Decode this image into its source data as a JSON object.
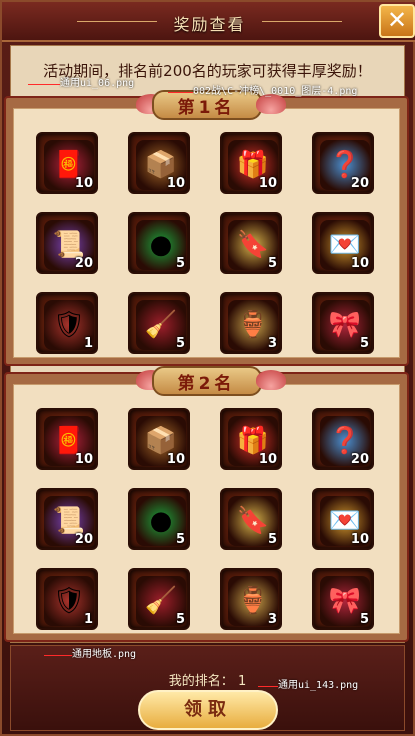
{
  "window": {
    "title": "奖励查看",
    "close_label": "✕"
  },
  "notice": "活动期间，排名前200名的玩家可获得丰厚奖励！",
  "rank_banners": [
    "第1名",
    "第2名"
  ],
  "items": [
    {
      "name": "purse-icon",
      "count": "10",
      "glyph": "🧧",
      "color": "#b4233e"
    },
    {
      "name": "treasure-box-icon",
      "count": "10",
      "glyph": "📦",
      "color": "#a76a2a"
    },
    {
      "name": "gift-box-icon",
      "count": "10",
      "glyph": "🎁",
      "color": "#d9312a"
    },
    {
      "name": "blue-orb-chest-icon",
      "count": "20",
      "glyph": "❓",
      "color": "#4b8fd1"
    },
    {
      "name": "purple-scroll-icon",
      "count": "20",
      "glyph": "📜",
      "color": "#7a44b8"
    },
    {
      "name": "jade-gem-icon",
      "count": "5",
      "glyph": "●",
      "color": "#1ba33c"
    },
    {
      "name": "master-token-icon",
      "count": "5",
      "glyph": "🔖",
      "color": "#d6b24a"
    },
    {
      "name": "fortune-envelope-icon",
      "count": "10",
      "glyph": "💌",
      "color": "#d39b2f"
    },
    {
      "name": "armor-icon",
      "count": "1",
      "glyph": "🛡",
      "color": "#a9332c"
    },
    {
      "name": "whisk-icon",
      "count": "5",
      "glyph": "🧹",
      "color": "#9e1f2b"
    },
    {
      "name": "golden-plaque-icon",
      "count": "3",
      "glyph": "🏺",
      "color": "#c9a24a"
    },
    {
      "name": "red-whip-icon",
      "count": "5",
      "glyph": "🎀",
      "color": "#b0263c"
    }
  ],
  "annotations": [
    "通用ui_06.png",
    "002战\\C-冲榜\\_0010_图层-4.png",
    "通用地板.png",
    "通用ui_143.png"
  ],
  "footer": {
    "rank_label": "我的排名：",
    "rank_value": "1",
    "claim_button": "领取"
  }
}
